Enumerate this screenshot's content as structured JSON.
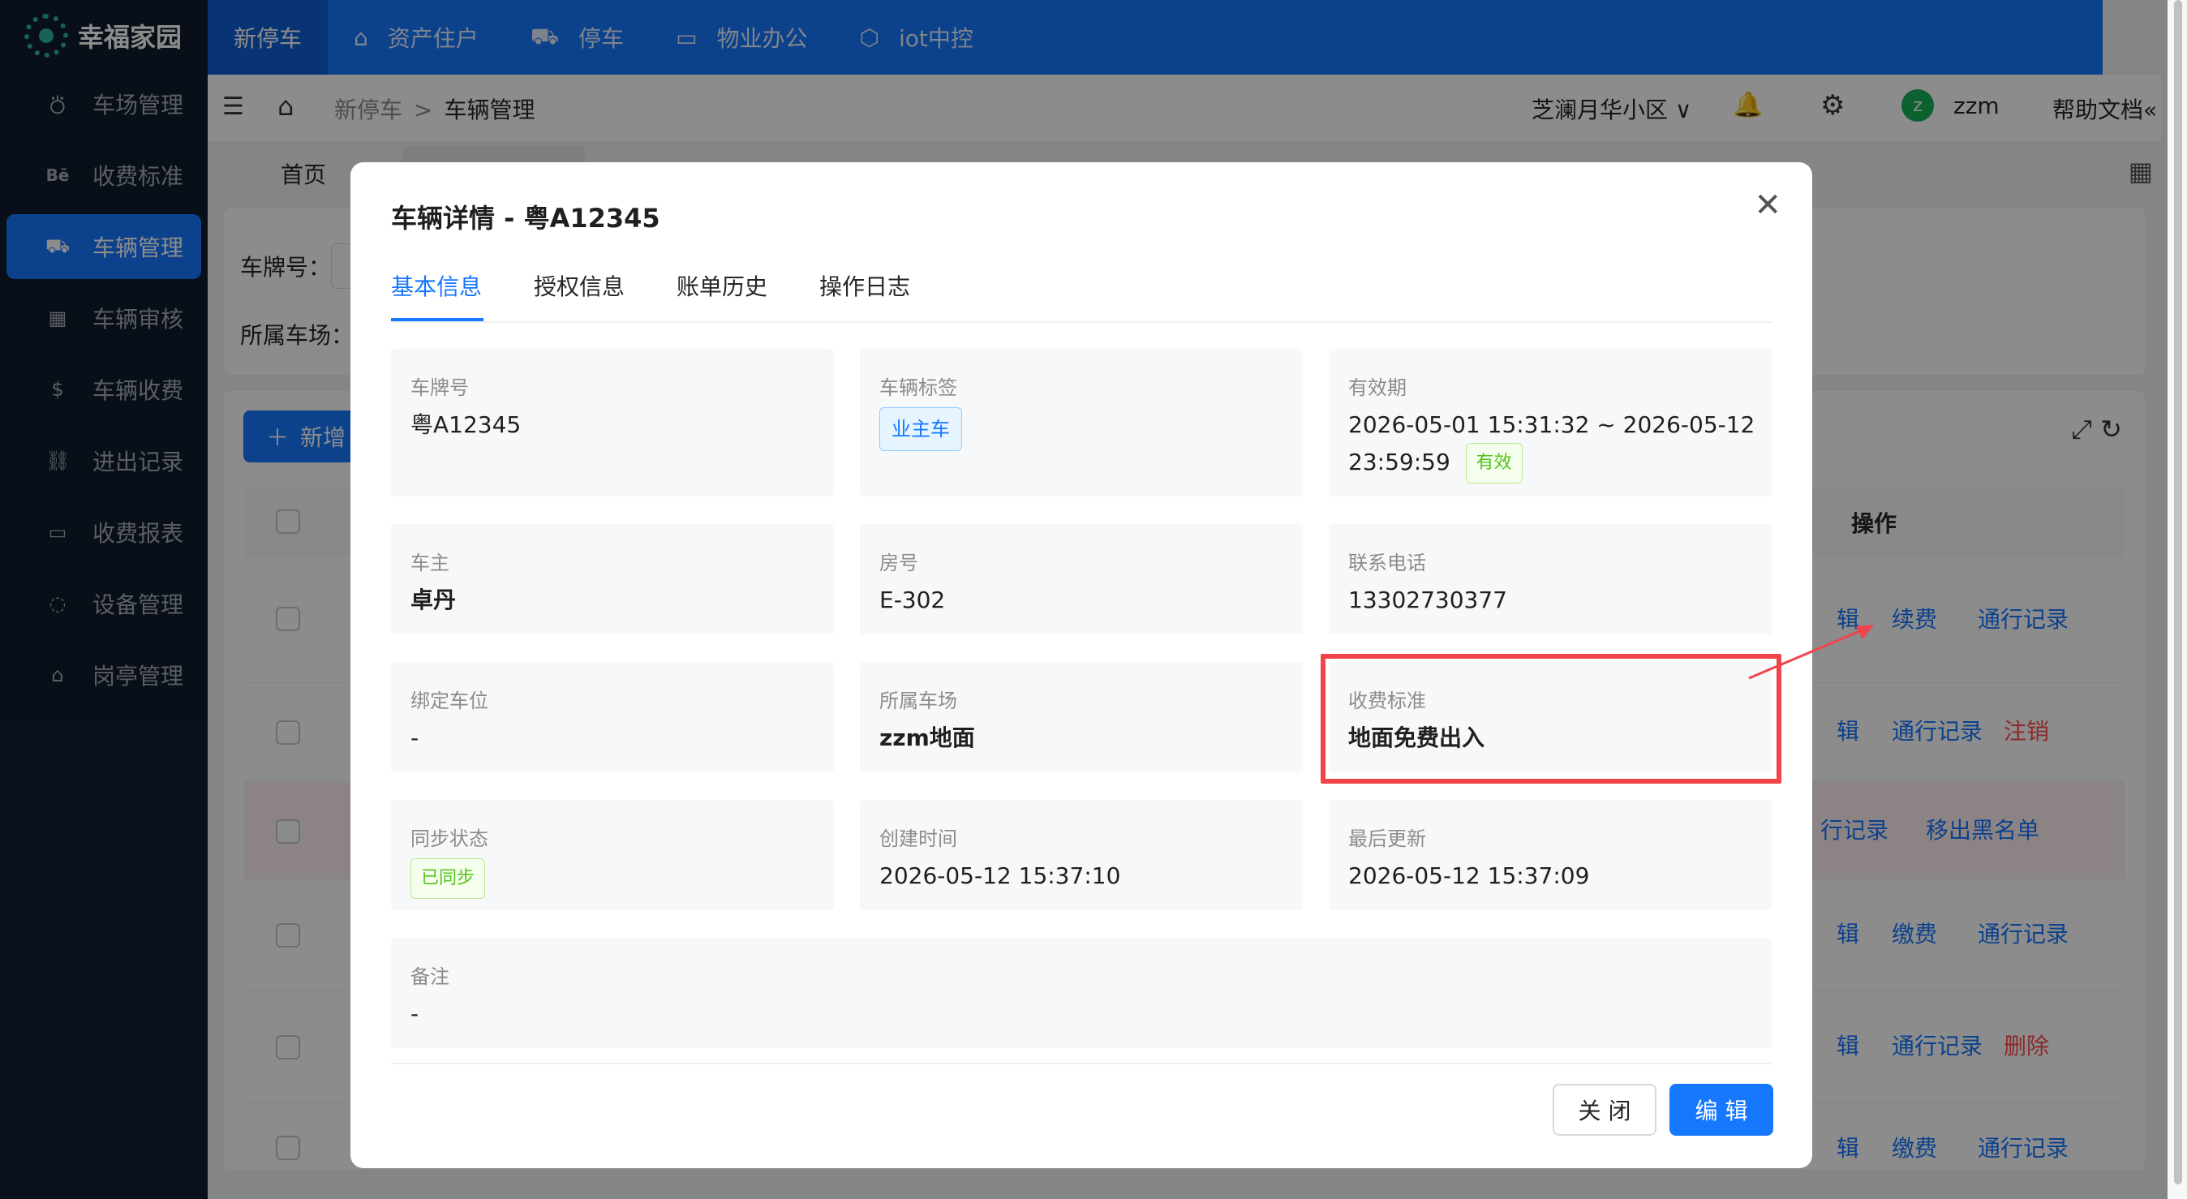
{
  "brand": {
    "name": "幸福家园"
  },
  "sidebar": {
    "items": [
      {
        "label": "车场管理",
        "icon": "parking-lot-icon",
        "glyph": "⛣"
      },
      {
        "label": "收费标准",
        "icon": "behance-icon",
        "glyph": "Bē"
      },
      {
        "label": "车辆管理",
        "icon": "car-icon",
        "glyph": "⛟",
        "active": true
      },
      {
        "label": "车辆审核",
        "icon": "building-icon",
        "glyph": "▦"
      },
      {
        "label": "车辆收费",
        "icon": "dollar-icon",
        "glyph": "$"
      },
      {
        "label": "进出记录",
        "icon": "link-icon",
        "glyph": "⛓"
      },
      {
        "label": "收费报表",
        "icon": "monitor-icon",
        "glyph": "▭"
      },
      {
        "label": "设备管理",
        "icon": "message-icon",
        "glyph": "◌"
      },
      {
        "label": "岗亭管理",
        "icon": "bank-icon",
        "glyph": "⌂"
      }
    ]
  },
  "topnav": {
    "items": [
      {
        "label": "新停车",
        "active": true
      },
      {
        "label": "资产住户",
        "icon": "home-icon"
      },
      {
        "label": "停车",
        "icon": "car-icon"
      },
      {
        "label": "物业办公",
        "icon": "laptop-icon"
      },
      {
        "label": "iot中控",
        "icon": "cube-icon"
      }
    ]
  },
  "header": {
    "breadcrumb": [
      "新停车",
      "车辆管理"
    ],
    "breadcrumb_sep": ">",
    "community": "芝澜月华小区",
    "user": "zzm",
    "user_initial": "z",
    "help": "帮助文档«"
  },
  "tabs": {
    "home": "首页"
  },
  "background": {
    "search_labels": {
      "plate": "车牌号：",
      "lot": "所属车场："
    },
    "add_button": "新增",
    "op_header": "操作",
    "rows": [
      {
        "actions": [
          {
            "label": "辑"
          },
          {
            "label": "续费"
          },
          {
            "label": "通行记录"
          }
        ]
      },
      {
        "actions": [
          {
            "label": "辑"
          },
          {
            "label": "通行记录"
          },
          {
            "label": "注销",
            "danger": true
          }
        ]
      },
      {
        "actions": [
          {
            "label": "行记录"
          },
          {
            "label": "移出黑名单"
          }
        ]
      },
      {
        "actions": [
          {
            "label": "辑"
          },
          {
            "label": "缴费"
          },
          {
            "label": "通行记录"
          }
        ]
      },
      {
        "actions": [
          {
            "label": "辑"
          },
          {
            "label": "通行记录"
          },
          {
            "label": "删除",
            "danger": true
          }
        ]
      },
      {
        "actions": [
          {
            "label": "辑"
          },
          {
            "label": "缴费"
          },
          {
            "label": "通行记录"
          }
        ]
      }
    ]
  },
  "modal": {
    "title": "车辆详情 - 粤A12345",
    "tabs": [
      "基本信息",
      "授权信息",
      "账单历史",
      "操作日志"
    ],
    "active_tab": 0,
    "fields": {
      "plate": {
        "label": "车牌号",
        "value": "粤A12345"
      },
      "tag": {
        "label": "车辆标签",
        "value": "业主车"
      },
      "validity": {
        "label": "有效期",
        "value_line1": "2026-05-01 15:31:32 ~ 2026-05-12",
        "value_line2": "23:59:59",
        "status": "有效"
      },
      "owner": {
        "label": "车主",
        "value": "卓丹"
      },
      "room": {
        "label": "房号",
        "value": "E-302"
      },
      "phone": {
        "label": "联系电话",
        "value": "13302730377"
      },
      "space": {
        "label": "绑定车位",
        "value": "-"
      },
      "lot": {
        "label": "所属车场",
        "value": "zzm地面"
      },
      "fee_standard": {
        "label": "收费标准",
        "value": "地面免费出入"
      },
      "sync": {
        "label": "同步状态",
        "value": "已同步"
      },
      "created": {
        "label": "创建时间",
        "value": "2026-05-12 15:37:10"
      },
      "updated": {
        "label": "最后更新",
        "value": "2026-05-12 15:37:09"
      },
      "remark": {
        "label": "备注",
        "value": "-"
      }
    },
    "buttons": {
      "close": "关 闭",
      "edit": "编 辑"
    }
  },
  "colors": {
    "primary": "#1677ff",
    "sidebar_bg": "#0f1d2f",
    "highlight": "#f0444a",
    "success": "#52c41a",
    "danger": "#ff4d4f"
  }
}
